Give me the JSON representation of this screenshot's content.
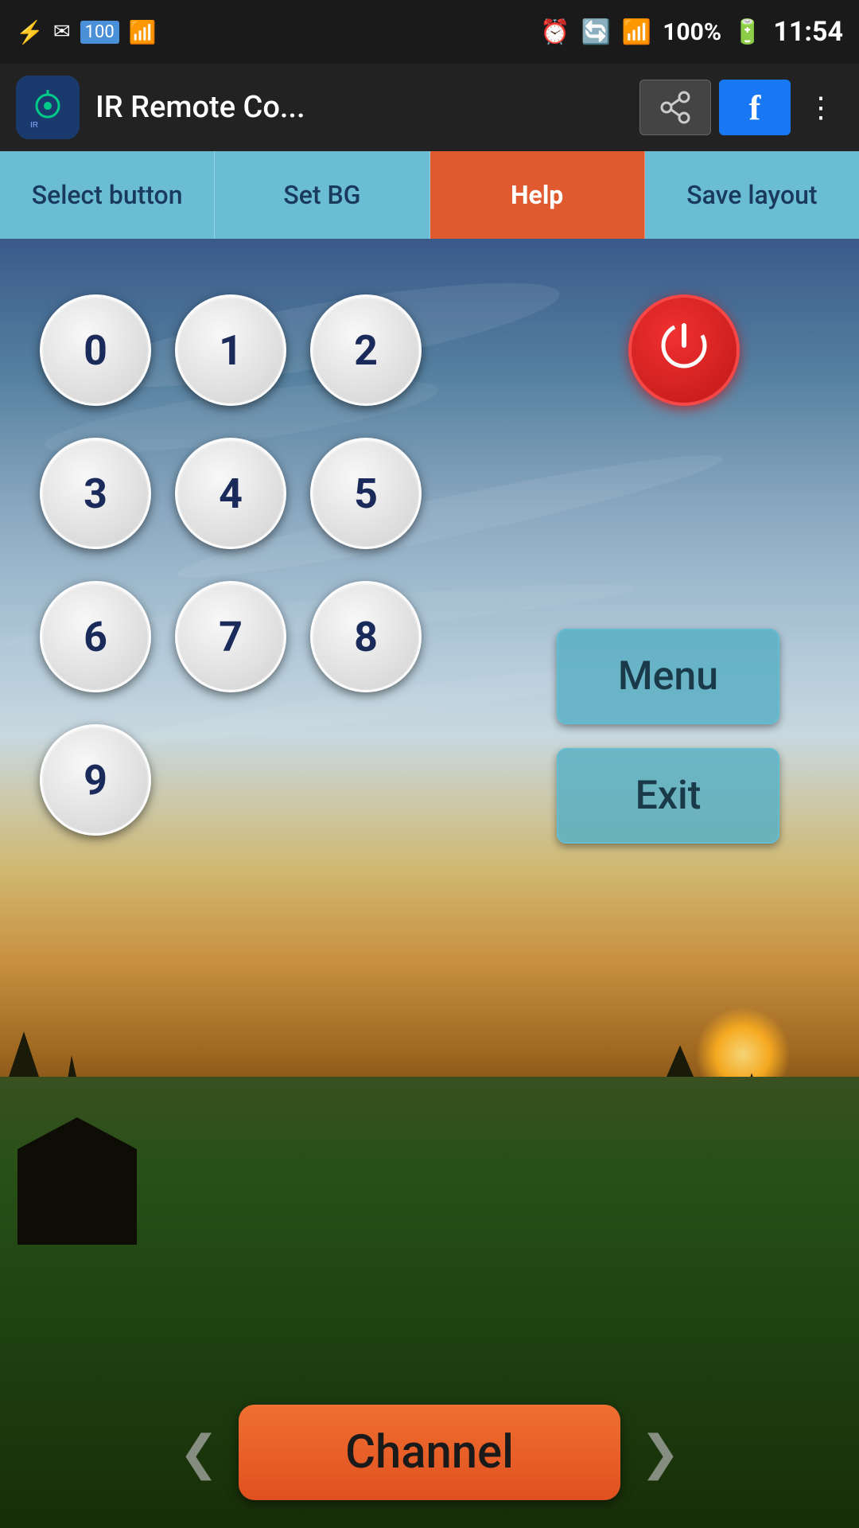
{
  "statusBar": {
    "time": "11:54",
    "battery": "100%",
    "batteryIcon": "🔋",
    "wifiIcon": "📶",
    "signalIcon": "📶",
    "alarmIcon": "⏰",
    "usbIcon": "⚡",
    "emailIcon": "✉",
    "batteryPercent": "100"
  },
  "appBar": {
    "title": "IR Remote Co...",
    "shareLabel": "⬆",
    "fbLabel": "f",
    "moreLabel": "⋮",
    "appIconLabel": "IR"
  },
  "tabs": [
    {
      "id": "select",
      "label": "Select button",
      "active": false
    },
    {
      "id": "setbg",
      "label": "Set BG",
      "active": false
    },
    {
      "id": "help",
      "label": "Help",
      "active": true
    },
    {
      "id": "savelayout",
      "label": "Save layout",
      "active": false
    }
  ],
  "remote": {
    "numbers": [
      "0",
      "1",
      "2",
      "3",
      "4",
      "5",
      "6",
      "7",
      "8",
      "9"
    ],
    "powerSymbol": "⏻",
    "menuLabel": "Menu",
    "exitLabel": "Exit"
  },
  "bottom": {
    "channelLabel": "Channel",
    "prevArrow": "❮",
    "nextArrow": "❯"
  }
}
